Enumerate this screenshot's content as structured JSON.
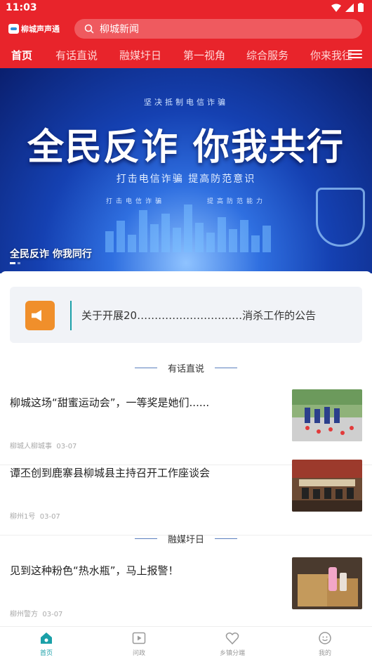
{
  "status_bar": {
    "time": "11:03"
  },
  "app": {
    "logo_text": "柳城声声通"
  },
  "search": {
    "placeholder": "柳城新闻"
  },
  "tabs": [
    "首页",
    "有话直说",
    "融媒圩日",
    "第一视角",
    "综合服务",
    "你来我往"
  ],
  "banner": {
    "small_top": "坚决抵制电信诈骗",
    "headline": "全民反诈  你我共行",
    "sub": "打击电信诈骗 提高防范意识",
    "sub2_left": "打击电信诈骗",
    "sub2_right": "提高防范能力",
    "caption": "全民反诈 你我同行"
  },
  "notice": {
    "text": "关于开展20…………………………消杀工作的公告"
  },
  "sections": [
    {
      "title": "有话直说",
      "items": [
        {
          "title": "柳城这场“甜蜜运动会”，一等奖是她们......",
          "source": "柳城人柳城事",
          "date": "03-07"
        },
        {
          "title": "谭丕创到鹿寨县柳城县主持召开工作座谈会",
          "source": "柳州1号",
          "date": "03-07"
        }
      ]
    },
    {
      "title": "融媒圩日",
      "items": [
        {
          "title": "见到这种粉色“热水瓶”，马上报警！",
          "source": "柳州警方",
          "date": "03-07"
        }
      ]
    }
  ],
  "bottom_nav": [
    "首页",
    "问政",
    "乡镇分端",
    "我的"
  ],
  "colors": {
    "brand_red": "#e8242b",
    "accent_teal": "#1aa0a8"
  }
}
